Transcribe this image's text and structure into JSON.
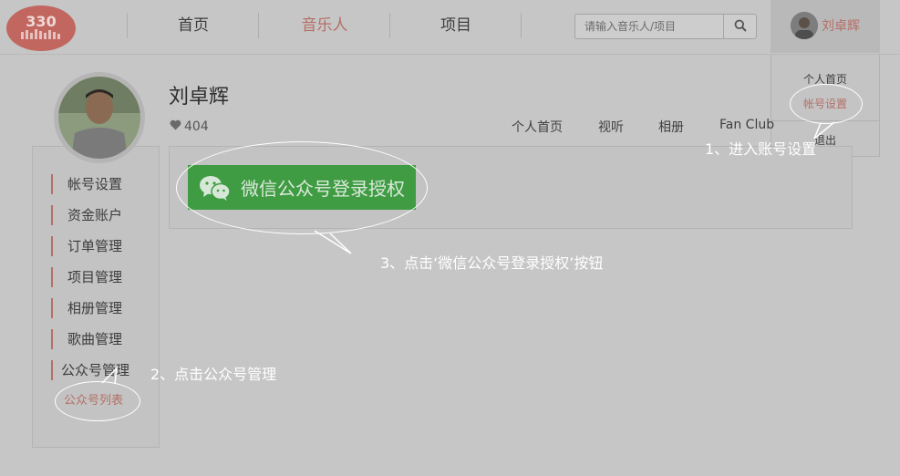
{
  "header": {
    "logo_text": "330",
    "nav": [
      {
        "label": "首页",
        "active": false
      },
      {
        "label": "音乐人",
        "active": true
      },
      {
        "label": "项目",
        "active": false
      }
    ],
    "search": {
      "placeholder": "请输入音乐人/项目",
      "value": ""
    },
    "user": {
      "name": "刘卓辉"
    }
  },
  "dropdown": {
    "items": [
      "个人首页",
      "帐号设置",
      "退出"
    ],
    "active_index": 1
  },
  "profile": {
    "name": "刘卓辉",
    "likes": "404",
    "tabs": [
      "个人首页",
      "视听",
      "相册",
      "Fan Club"
    ]
  },
  "sidebar": {
    "items": [
      "帐号设置",
      "资金账户",
      "订单管理",
      "项目管理",
      "相册管理",
      "歌曲管理",
      "公众号管理"
    ],
    "sub_item": "公众号列表"
  },
  "main": {
    "wechat_button": "微信公众号登录授权"
  },
  "annotations": {
    "step1": "1、进入账号设置",
    "step2": "2、点击公众号管理",
    "step3": "3、点击‘微信公众号登录授权’按钮"
  },
  "colors": {
    "accent": "#b56f67",
    "wechat_green": "#3f9c43",
    "overlay_bg": "#c6c6c6"
  }
}
